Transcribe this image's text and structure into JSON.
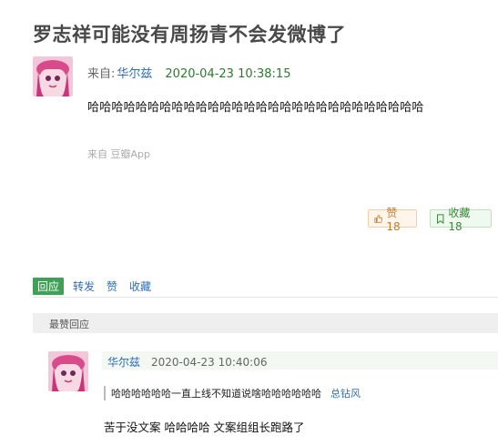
{
  "post": {
    "title": "罗志祥可能没有周扬青不会发微博了",
    "from_label": "来自:",
    "username": "华尔兹",
    "timestamp": "2020-04-23 10:38:15",
    "body": "哈哈哈哈哈哈哈哈哈哈哈哈哈哈哈哈哈哈哈哈哈哈哈哈哈哈哈哈",
    "source": "来自 豆瓣App"
  },
  "buttons": {
    "like_label": "赞 18",
    "collect_label": "收藏 18"
  },
  "actions": {
    "reply": "回应",
    "forward": "转发",
    "like": "赞",
    "collect": "收藏"
  },
  "hot_replies": {
    "header": "最赞回应",
    "items": [
      {
        "username": "华尔兹",
        "timestamp": "2020-04-23 10:40:06",
        "quote": "哈哈哈哈哈哈一直上线不知道说啥哈哈哈哈哈哈",
        "quote_author": "总钻风",
        "text": "苦于没文案 哈哈哈哈 文案组组长跑路了"
      }
    ]
  },
  "colors": {
    "link": "#2f6db6",
    "timestamp_green": "#2b7a2b",
    "reply_tab_bg": "#3fa157"
  }
}
